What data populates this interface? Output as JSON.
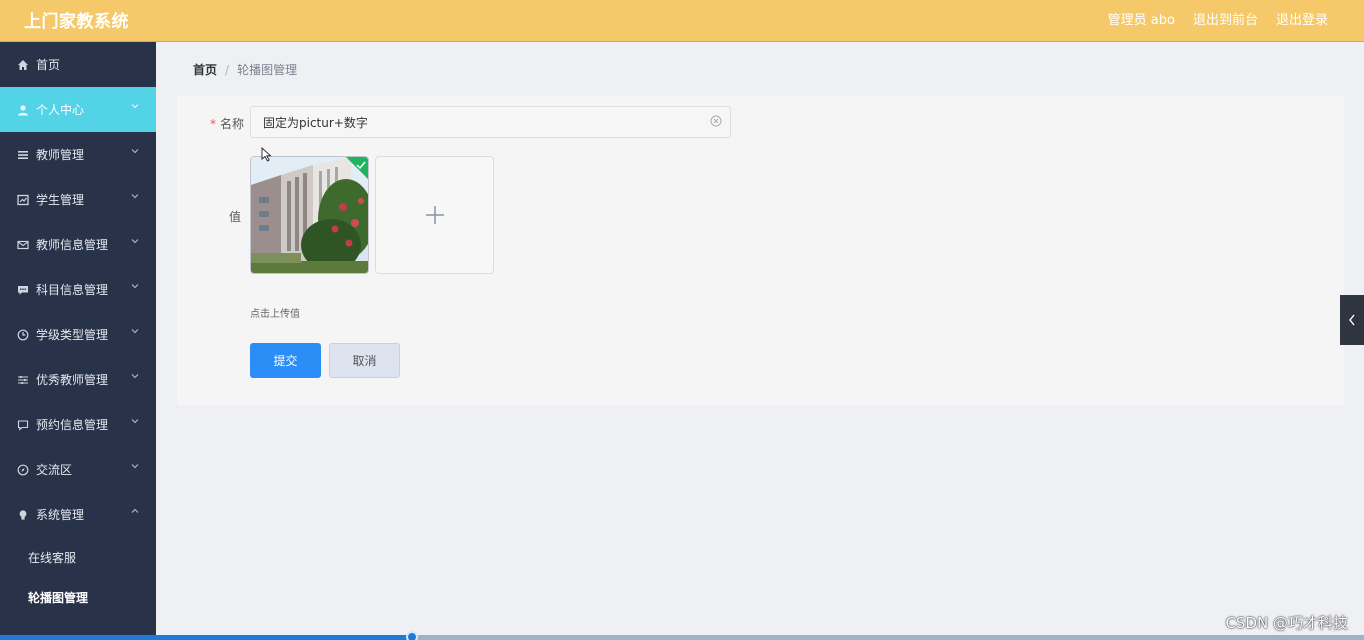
{
  "app": {
    "title": "上门家教系统"
  },
  "header": {
    "admin_label": "管理员 abo",
    "front_label": "退出到前台",
    "logout_label": "退出登录"
  },
  "sidebar": {
    "items": [
      {
        "label": "首页",
        "icon": "home-icon"
      },
      {
        "label": "个人中心",
        "icon": "user-icon"
      },
      {
        "label": "教师管理",
        "icon": "menu-icon"
      },
      {
        "label": "学生管理",
        "icon": "chart-icon"
      },
      {
        "label": "教师信息管理",
        "icon": "mail-icon"
      },
      {
        "label": "科目信息管理",
        "icon": "comment-icon"
      },
      {
        "label": "学级类型管理",
        "icon": "clock-icon"
      },
      {
        "label": "优秀教师管理",
        "icon": "sliders-icon"
      },
      {
        "label": "预约信息管理",
        "icon": "chat-icon"
      },
      {
        "label": "交流区",
        "icon": "compass-icon"
      },
      {
        "label": "系统管理",
        "icon": "bulb-icon"
      }
    ],
    "sub_items": [
      {
        "label": "在线客服"
      },
      {
        "label": "轮播图管理"
      }
    ]
  },
  "breadcrumb": {
    "home": "首页",
    "separator": "/",
    "current": "轮播图管理"
  },
  "form": {
    "name_label": "名称",
    "name_required_mark": "*",
    "name_value": "固定为pictur+数字",
    "value_label": "值",
    "upload_hint": "点击上传值",
    "submit_label": "提交",
    "cancel_label": "取消"
  },
  "watermark": "CSDN @巧才科技",
  "progress": {
    "percent": 30.2
  },
  "colors": {
    "header": "#f5c96a",
    "sidebar": "#28334a",
    "active": "#53d3e6",
    "primary": "#2b8ef7"
  }
}
